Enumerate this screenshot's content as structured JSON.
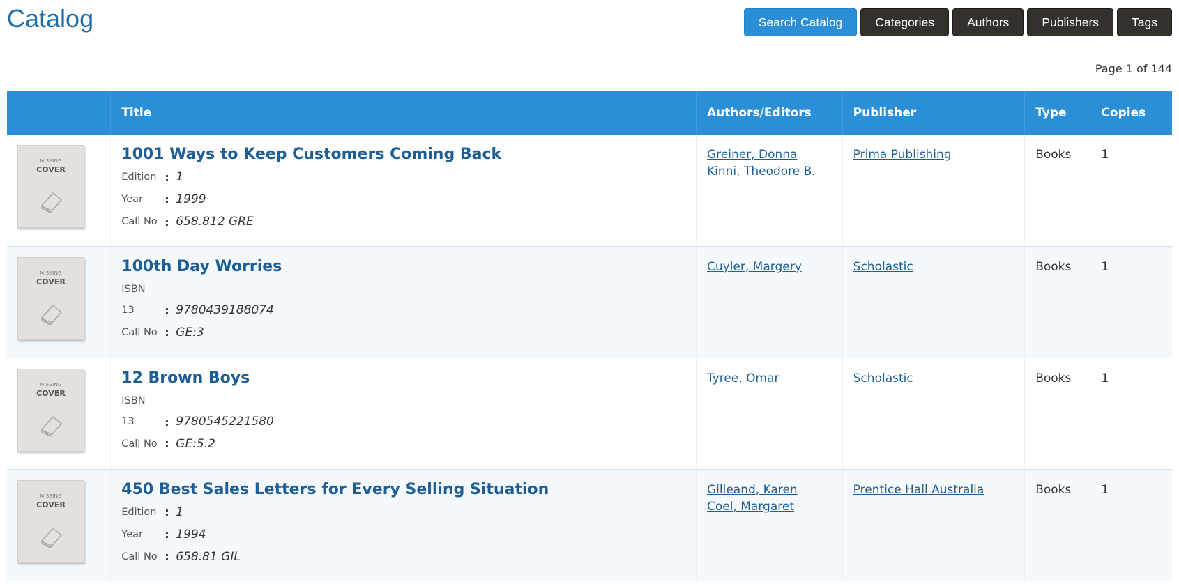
{
  "header": {
    "title": "Catalog",
    "nav": [
      {
        "label": "Search Catalog",
        "primary": true
      },
      {
        "label": "Categories"
      },
      {
        "label": "Authors"
      },
      {
        "label": "Publishers"
      },
      {
        "label": "Tags"
      }
    ],
    "pager": "Page 1 of 144"
  },
  "table": {
    "columns": [
      "",
      "Title",
      "Authors/Editors",
      "Publisher",
      "Type",
      "Copies"
    ],
    "cover": {
      "line1": "MISSING",
      "line2": "COVER"
    },
    "rows": [
      {
        "title": "1001 Ways to Keep Customers Coming Back",
        "fields": [
          {
            "k1": "Edition",
            "v": "1"
          },
          {
            "k1": "Year",
            "v": "1999"
          },
          {
            "k1": "Call No",
            "v": "658.812 GRE"
          }
        ],
        "authors": [
          "Greiner, Donna",
          "Kinni, Theodore B."
        ],
        "publisher": "Prima Publishing",
        "type": "Books",
        "copies": "1"
      },
      {
        "title": "100th Day Worries",
        "fields": [
          {
            "k1": "ISBN",
            "k2": "13",
            "v": "9780439188074"
          },
          {
            "k1": "Call No",
            "v": "GE:3"
          }
        ],
        "authors": [
          "Cuyler, Margery"
        ],
        "publisher": "Scholastic",
        "type": "Books",
        "copies": "1"
      },
      {
        "title": "12 Brown Boys",
        "fields": [
          {
            "k1": "ISBN",
            "k2": "13",
            "v": "9780545221580"
          },
          {
            "k1": "Call No",
            "v": "GE:5.2"
          }
        ],
        "authors": [
          "Tyree, Omar"
        ],
        "publisher": "Scholastic",
        "type": "Books",
        "copies": "1"
      },
      {
        "title": "450 Best Sales Letters for Every Selling Situation",
        "fields": [
          {
            "k1": "Edition",
            "v": "1"
          },
          {
            "k1": "Year",
            "v": "1994"
          },
          {
            "k1": "Call No",
            "v": "658.81 GIL"
          }
        ],
        "authors": [
          "Gilleand, Karen",
          "Coel, Margaret"
        ],
        "publisher": "Prentice Hall Australia",
        "type": "Books",
        "copies": "1"
      }
    ]
  }
}
